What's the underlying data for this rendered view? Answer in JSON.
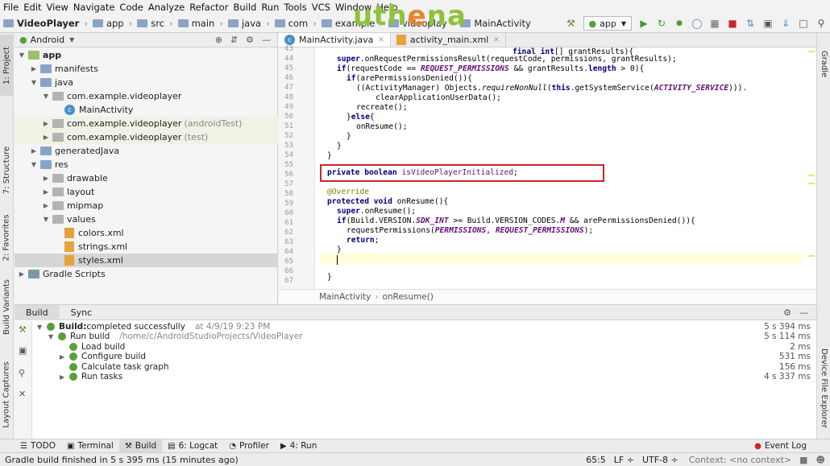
{
  "menu": [
    "File",
    "Edit",
    "View",
    "Navigate",
    "Code",
    "Analyze",
    "Refactor",
    "Build",
    "Run",
    "Tools",
    "VCS",
    "Window",
    "Help"
  ],
  "logo": {
    "text_a": "uth",
    "text_b": "e",
    "text_c": "na"
  },
  "breadcrumbs": [
    "VideoPlayer",
    "app",
    "src",
    "main",
    "java",
    "com",
    "example",
    "videoplay",
    "MainActivity"
  ],
  "run_config": "app",
  "project_panel": {
    "view_mode": "Android",
    "tree": [
      {
        "label": "app",
        "indent": 0,
        "icon": "folder-green",
        "expanded": true,
        "bold": true
      },
      {
        "label": "manifests",
        "indent": 1,
        "icon": "folder-blue",
        "expanded": false
      },
      {
        "label": "java",
        "indent": 1,
        "icon": "folder-blue",
        "expanded": true
      },
      {
        "label": "com.example.videoplayer",
        "indent": 2,
        "icon": "folder-gray",
        "expanded": true
      },
      {
        "label": "MainActivity",
        "indent": 3,
        "icon": "class"
      },
      {
        "label": "com.example.videoplayer",
        "suffix": "(androidTest)",
        "indent": 2,
        "icon": "folder-gray",
        "expanded": false,
        "alt": true
      },
      {
        "label": "com.example.videoplayer",
        "suffix": "(test)",
        "indent": 2,
        "icon": "folder-gray",
        "expanded": false,
        "alt": true
      },
      {
        "label": "generatedJava",
        "indent": 1,
        "icon": "folder-blue",
        "expanded": false
      },
      {
        "label": "res",
        "indent": 1,
        "icon": "folder-blue",
        "expanded": true
      },
      {
        "label": "drawable",
        "indent": 2,
        "icon": "folder-gray",
        "expanded": false
      },
      {
        "label": "layout",
        "indent": 2,
        "icon": "folder-gray",
        "expanded": false
      },
      {
        "label": "mipmap",
        "indent": 2,
        "icon": "folder-gray",
        "expanded": false
      },
      {
        "label": "values",
        "indent": 2,
        "icon": "folder-gray",
        "expanded": true
      },
      {
        "label": "colors.xml",
        "indent": 3,
        "icon": "xml"
      },
      {
        "label": "strings.xml",
        "indent": 3,
        "icon": "xml"
      },
      {
        "label": "styles.xml",
        "indent": 3,
        "icon": "xml",
        "selected": true
      },
      {
        "label": "Gradle Scripts",
        "indent": 0,
        "icon": "gradle",
        "expanded": false
      }
    ]
  },
  "left_tabs": [
    "1: Project",
    "7: Structure",
    "2: Favorites",
    "Build Variants",
    "Layout Captures"
  ],
  "right_tabs": [
    "Gradle",
    "Device File Explorer"
  ],
  "editor": {
    "tabs": [
      {
        "label": "MainActivity.java",
        "active": true
      },
      {
        "label": "activity_main.xml",
        "active": false
      }
    ],
    "line_numbers": [
      "43",
      "44",
      "45",
      "46",
      "47",
      "48",
      "49",
      "50",
      "51",
      "52",
      "53",
      "54",
      "55",
      "56",
      "57",
      "58",
      "59",
      "60",
      "61",
      "62",
      "63",
      "64",
      "65",
      "66",
      "67"
    ],
    "breadcrumb": [
      "MainActivity",
      "onResume()"
    ]
  },
  "bottom_panel": {
    "tabs": [
      "Build",
      "Sync"
    ],
    "rows": [
      {
        "label": "Build:",
        "rest": " completed successfully",
        "at": "at 4/9/19 9:23 PM",
        "time": "5 s 394 ms",
        "indent": 0,
        "bold": true
      },
      {
        "label": "Run build",
        "rest": "",
        "at": "/home/c/AndroidStudioProjects/VideoPlayer",
        "time": "5 s 114 ms",
        "indent": 1
      },
      {
        "label": "Load build",
        "rest": "",
        "at": "",
        "time": "2 ms",
        "indent": 2
      },
      {
        "label": "Configure build",
        "rest": "",
        "at": "",
        "time": "531 ms",
        "indent": 2
      },
      {
        "label": "Calculate task graph",
        "rest": "",
        "at": "",
        "time": "156 ms",
        "indent": 2
      },
      {
        "label": "Run tasks",
        "rest": "",
        "at": "",
        "time": "4 s 337 ms",
        "indent": 2
      }
    ]
  },
  "status_tabs": [
    {
      "label": "TODO",
      "icon": "list-icon"
    },
    {
      "label": "Terminal",
      "icon": "terminal-icon"
    },
    {
      "label": "Build",
      "icon": "hammer-icon",
      "active": true
    },
    {
      "label": "6: Logcat",
      "icon": "logcat-icon"
    },
    {
      "label": "Profiler",
      "icon": "profiler-icon"
    },
    {
      "label": "4: Run",
      "icon": "run-icon"
    }
  ],
  "event_log": "Event Log",
  "footer": {
    "message": "Gradle build finished in 5 s 395 ms (15 minutes ago)",
    "position": "65:5",
    "line_sep": "LF ÷",
    "encoding": "UTF-8 ÷",
    "context": "Context: <no context>"
  }
}
